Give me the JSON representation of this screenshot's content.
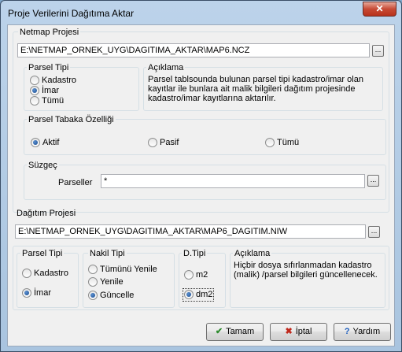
{
  "window": {
    "title": "Proje Verilerini Dağıtıma Aktar",
    "close_label": "✕"
  },
  "netmap": {
    "label": "Netmap Projesi",
    "path": "E:\\NETMAP_ORNEK_UYG\\DAGITIMA_AKTAR\\MAP6.NCZ",
    "browse_label": "...",
    "parsel_tipi": {
      "label": "Parsel Tipi",
      "options": [
        "Kadastro",
        "İmar",
        "Tümü"
      ],
      "selected": "İmar"
    },
    "aciklama": {
      "label": "Açıklama",
      "lines": [
        "Parsel tablsounda bulunan parsel tipi kadastro/imar olan",
        "kayıtlar ile bunlara ait malik bilgileri dağıtım projesinde",
        "kadastro/imar kayıtlarına aktarılır."
      ]
    },
    "tabaka": {
      "label": "Parsel Tabaka Özelliği",
      "options": [
        "Aktif",
        "Pasif",
        "Tümü"
      ],
      "selected": "Aktif"
    },
    "suzgec": {
      "label": "Süzgeç",
      "field_label": "Parseller",
      "value": "*",
      "browse_label": "..."
    }
  },
  "dagitim": {
    "label": "Dağıtım Projesi",
    "path": "E:\\NETMAP_ORNEK_UYG\\DAGITIMA_AKTAR\\MAP6_DAGITIM.NIW",
    "browse_label": "...",
    "parsel_tipi": {
      "label": "Parsel Tipi",
      "options": [
        "Kadastro",
        "İmar"
      ],
      "selected": "İmar"
    },
    "nakil_tipi": {
      "label": "Nakil Tipi",
      "options": [
        "Tümünü Yenile",
        "Yenile",
        "Güncelle"
      ],
      "selected": "Güncelle"
    },
    "d_tipi": {
      "label": "D.Tipi",
      "options": [
        "m2",
        "dm2"
      ],
      "selected": "dm2"
    },
    "aciklama": {
      "label": "Açıklama",
      "lines": [
        "Hiçbir dosya sıfırlanmadan kadastro",
        "(malik) /parsel bilgileri güncellenecek."
      ]
    }
  },
  "buttons": {
    "ok": {
      "label": "Tamam",
      "icon": "check-icon",
      "color": "#2e8b2e"
    },
    "cancel": {
      "label": "İptal",
      "icon": "x-icon",
      "color": "#c0281c"
    },
    "help": {
      "label": "Yardım",
      "icon": "question-icon",
      "color": "#1f5fbf"
    }
  }
}
